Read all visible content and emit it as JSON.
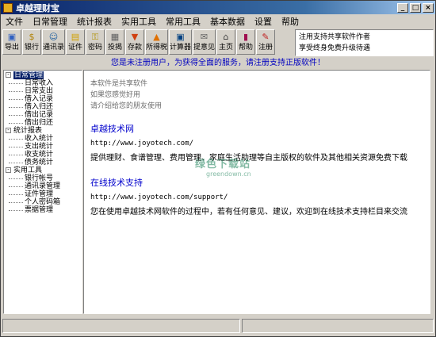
{
  "window": {
    "title": "卓越理财宝"
  },
  "menu": [
    "文件",
    "日常管理",
    "统计报表",
    "实用工具",
    "常用工具",
    "基本数据",
    "设置",
    "帮助"
  ],
  "toolbar": [
    {
      "label": "导出",
      "icon": "export-icon",
      "glyph": "▣",
      "color": "#3060c0"
    },
    {
      "label": "银行",
      "icon": "bank-icon",
      "glyph": "$",
      "color": "#b08000"
    },
    {
      "label": "通讯录",
      "icon": "contacts-icon",
      "glyph": "☺",
      "color": "#2060a0"
    },
    {
      "label": "证件",
      "icon": "id-card-icon",
      "glyph": "▤",
      "color": "#d0a000"
    },
    {
      "label": "密码",
      "icon": "key-icon",
      "glyph": "⚿",
      "color": "#b09000"
    },
    {
      "label": "投揭",
      "icon": "calculator-icon",
      "glyph": "▦",
      "color": "#606060"
    },
    {
      "label": "存款",
      "icon": "deposit-icon",
      "glyph": "▼",
      "color": "#d04010"
    },
    {
      "label": "所得税",
      "icon": "tax-icon",
      "glyph": "▲",
      "color": "#e07000"
    },
    {
      "label": "计算器",
      "icon": "computer-icon",
      "glyph": "▣",
      "color": "#004080"
    },
    {
      "label": "提意见",
      "icon": "suggestion-icon",
      "glyph": "✉",
      "color": "#606060"
    },
    {
      "label": "主页",
      "icon": "home-icon",
      "glyph": "⌂",
      "color": "#404040"
    },
    {
      "label": "帮助",
      "icon": "help-book-icon",
      "glyph": "▮",
      "color": "#a01050"
    },
    {
      "label": "注册",
      "icon": "register-icon",
      "glyph": "✎",
      "color": "#c02020"
    }
  ],
  "notice": {
    "line1": "注用支持共享软件作者",
    "line2": "享受终身免费升级待遇"
  },
  "subbar": "您是未注册用户，为获得全面的服务，请注册支持正版软件！",
  "tree": [
    {
      "label": "日常管理",
      "selected": true,
      "children": [
        "日常收入",
        "日常支出",
        "借入记录",
        "借入归还",
        "借出记录",
        "借出归还"
      ]
    },
    {
      "label": "统计报表",
      "selected": false,
      "children": [
        "收入统计",
        "支出统计",
        "收支统计",
        "债务统计"
      ]
    },
    {
      "label": "实用工具",
      "selected": false,
      "children": [
        "银行帐号",
        "通讯录管理",
        "证件管理",
        "个人密码箱",
        "票据管理"
      ]
    }
  ],
  "content": {
    "intro": [
      "本软件是共享软件",
      "如果您感觉好用",
      "请介绍给您的朋友使用"
    ],
    "sections": [
      {
        "title": "卓越技术网",
        "url": "http://www.joyotech.com/",
        "desc": "提供理财、食谱管理、费用管理、家庭生活助理等自主版权的软件及其他相关资源免费下载"
      },
      {
        "title": "在线技术支持",
        "url": "http://www.joyotech.com/support/",
        "desc": "您在使用卓越技术网软件的过程中，若有任何意见、建议，欢迎到在线技术支持栏目来交流"
      }
    ]
  },
  "watermark": {
    "main": "绿色下载站",
    "sub": "greendown.cn"
  }
}
